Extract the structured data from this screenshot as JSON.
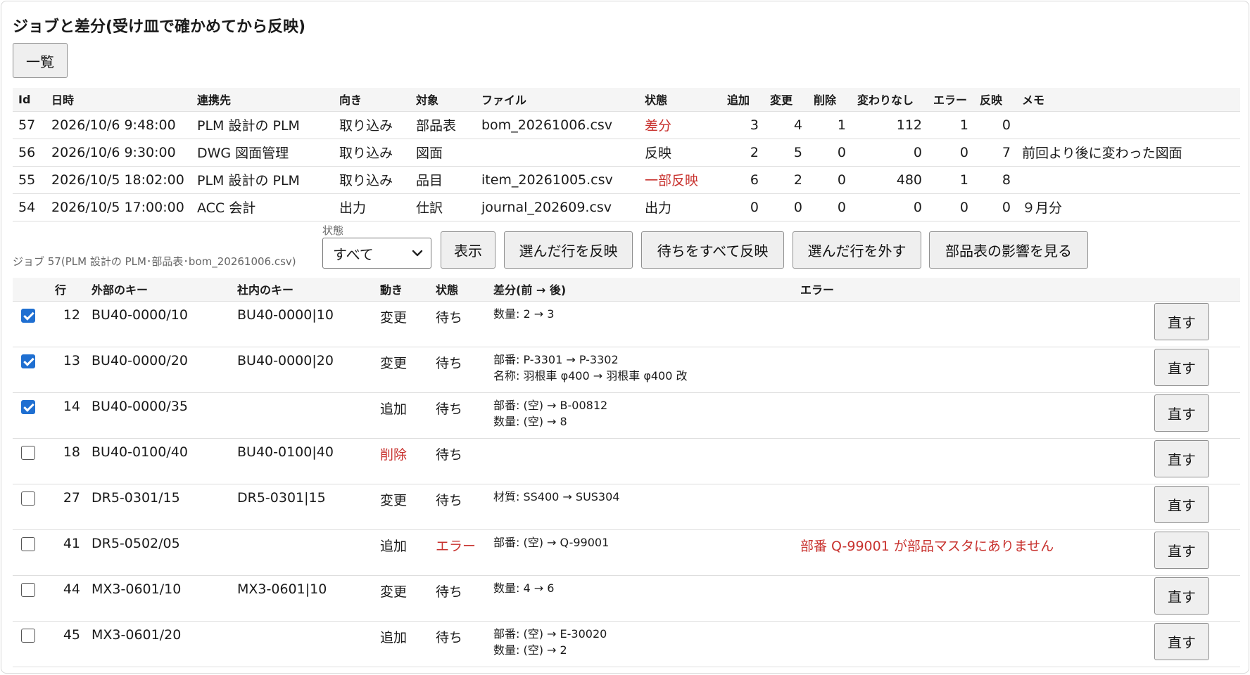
{
  "title": "ジョブと差分(受け皿で確かめてから反映)",
  "list_button": "一覧",
  "jobs": {
    "headers": [
      "Id",
      "日時",
      "連携先",
      "向き",
      "対象",
      "ファイル",
      "状態",
      "追加",
      "変更",
      "削除",
      "変わりなし",
      "エラー",
      "反映",
      "メモ"
    ],
    "rows": [
      {
        "id": "57",
        "datetime": "2026/10/6 9:48:00",
        "partner": "PLM 設計の PLM",
        "direction": "取り込み",
        "target": "部品表",
        "file": "bom_20261006.csv",
        "status": "差分",
        "status_color": "#c8322e",
        "add": "3",
        "change": "4",
        "delete": "1",
        "unchanged": "112",
        "error": "1",
        "applied": "0",
        "memo": ""
      },
      {
        "id": "56",
        "datetime": "2026/10/6 9:30:00",
        "partner": "DWG 図面管理",
        "direction": "取り込み",
        "target": "図面",
        "file": "",
        "status": "反映",
        "status_color": "#1a1a1a",
        "add": "2",
        "change": "5",
        "delete": "0",
        "unchanged": "0",
        "error": "0",
        "applied": "7",
        "memo": "前回より後に変わった図面"
      },
      {
        "id": "55",
        "datetime": "2026/10/5 18:02:00",
        "partner": "PLM 設計の PLM",
        "direction": "取り込み",
        "target": "品目",
        "file": "item_20261005.csv",
        "status": "一部反映",
        "status_color": "#c8322e",
        "add": "6",
        "change": "2",
        "delete": "0",
        "unchanged": "480",
        "error": "1",
        "applied": "8",
        "memo": ""
      },
      {
        "id": "54",
        "datetime": "2026/10/5 17:00:00",
        "partner": "ACC 会計",
        "direction": "出力",
        "target": "仕訳",
        "file": "journal_202609.csv",
        "status": "出力",
        "status_color": "#1a1a1a",
        "add": "0",
        "change": "0",
        "delete": "0",
        "unchanged": "0",
        "error": "0",
        "applied": "0",
        "memo": "９月分"
      }
    ]
  },
  "job_caption": "ジョブ 57(PLM 設計の PLM･部品表･bom_20261006.csv)",
  "filter": {
    "label": "状態",
    "value": "すべて"
  },
  "actions": {
    "show": "表示",
    "apply_selected": "選んだ行を反映",
    "apply_all_waiting": "待ちをすべて反映",
    "remove_selected": "選んだ行を外す",
    "bom_impact": "部品表の影響を見る"
  },
  "diff": {
    "headers": [
      "",
      "行",
      "外部のキー",
      "社内のキー",
      "動き",
      "状態",
      "差分(前 → 後)",
      "エラー",
      ""
    ],
    "fix_label": "直す",
    "rows": [
      {
        "checked": true,
        "line": "12",
        "ext_key": "BU40-0000/10",
        "int_key": "BU40-0000|10",
        "action": "変更",
        "action_color": "#1a1a1a",
        "state": "待ち",
        "state_color": "#1a1a1a",
        "diff1": "数量: 2 → 3",
        "diff2": "",
        "error": ""
      },
      {
        "checked": true,
        "line": "13",
        "ext_key": "BU40-0000/20",
        "int_key": "BU40-0000|20",
        "action": "変更",
        "action_color": "#1a1a1a",
        "state": "待ち",
        "state_color": "#1a1a1a",
        "diff1": "部番: P-3301 → P-3302",
        "diff2": "名称: 羽根車 φ400 → 羽根車 φ400 改",
        "error": ""
      },
      {
        "checked": true,
        "line": "14",
        "ext_key": "BU40-0000/35",
        "int_key": "",
        "action": "追加",
        "action_color": "#1a1a1a",
        "state": "待ち",
        "state_color": "#1a1a1a",
        "diff1": "部番: (空) → B-00812",
        "diff2": "数量: (空) → 8",
        "error": ""
      },
      {
        "checked": false,
        "line": "18",
        "ext_key": "BU40-0100/40",
        "int_key": "BU40-0100|40",
        "action": "削除",
        "action_color": "#c8322e",
        "state": "待ち",
        "state_color": "#1a1a1a",
        "diff1": "",
        "diff2": "",
        "error": ""
      },
      {
        "checked": false,
        "line": "27",
        "ext_key": "DR5-0301/15",
        "int_key": "DR5-0301|15",
        "action": "変更",
        "action_color": "#1a1a1a",
        "state": "待ち",
        "state_color": "#1a1a1a",
        "diff1": "材質: SS400 → SUS304",
        "diff2": "",
        "error": ""
      },
      {
        "checked": false,
        "line": "41",
        "ext_key": "DR5-0502/05",
        "int_key": "",
        "action": "追加",
        "action_color": "#1a1a1a",
        "state": "エラー",
        "state_color": "#c8322e",
        "diff1": "部番: (空) → Q-99001",
        "diff2": "",
        "error": "部番 Q-99001 が部品マスタにありません"
      },
      {
        "checked": false,
        "line": "44",
        "ext_key": "MX3-0601/10",
        "int_key": "MX3-0601|10",
        "action": "変更",
        "action_color": "#1a1a1a",
        "state": "待ち",
        "state_color": "#1a1a1a",
        "diff1": "数量: 4 → 6",
        "diff2": "",
        "error": ""
      },
      {
        "checked": false,
        "line": "45",
        "ext_key": "MX3-0601/20",
        "int_key": "",
        "action": "追加",
        "action_color": "#1a1a1a",
        "state": "待ち",
        "state_color": "#1a1a1a",
        "diff1": "部番: (空) → E-30020",
        "diff2": "数量: (空) → 2",
        "error": ""
      }
    ]
  },
  "colors": {
    "error": "#c8322e",
    "checkbox": "#1f6fd1",
    "header_bg": "#f5f5f5"
  }
}
